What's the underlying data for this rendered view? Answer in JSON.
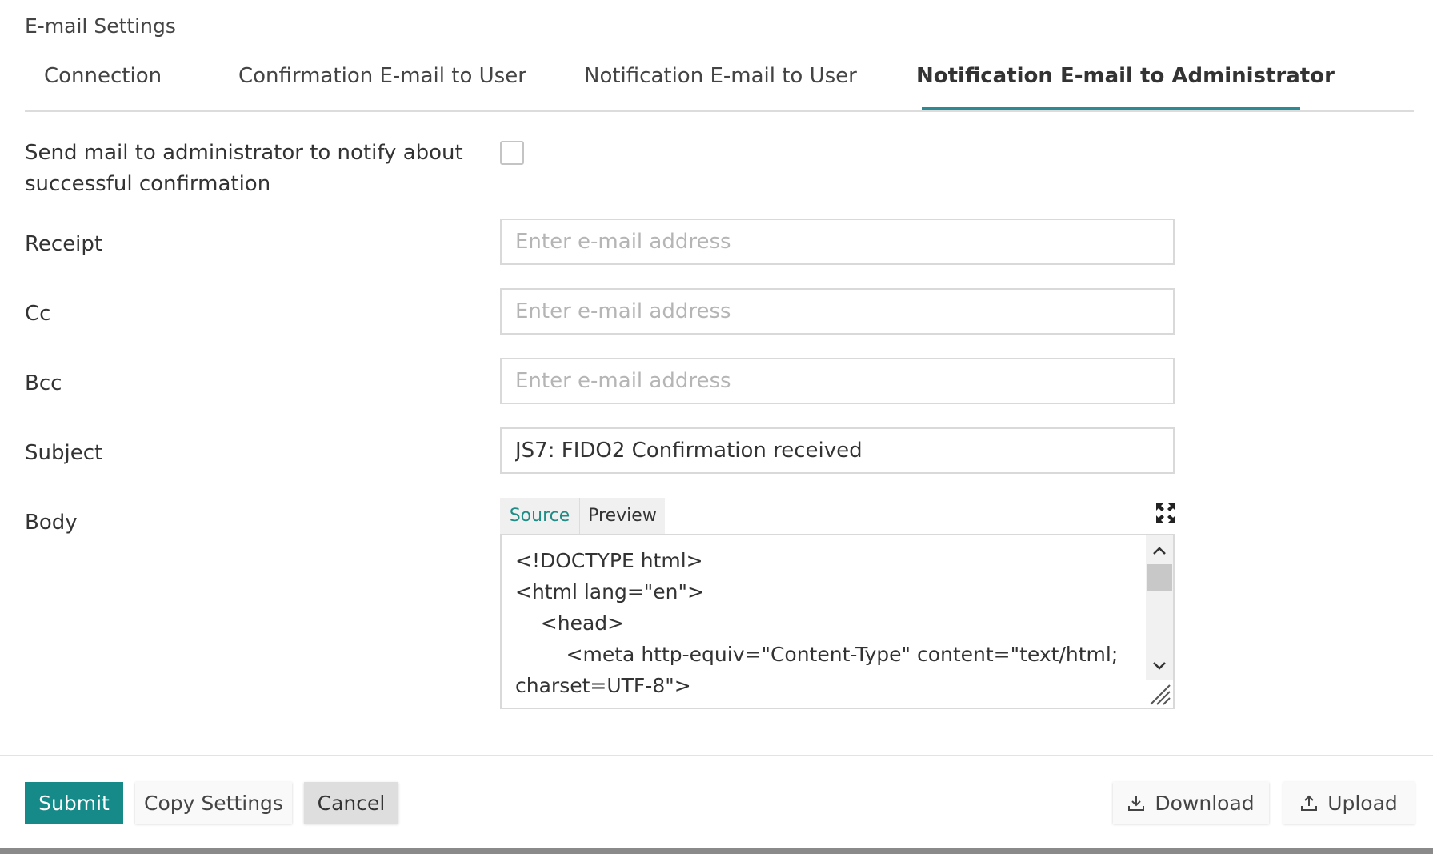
{
  "page": {
    "title": "E-mail Settings"
  },
  "tabs": [
    {
      "label": "Connection",
      "active": false
    },
    {
      "label": "Confirmation E-mail to User",
      "active": false
    },
    {
      "label": "Notification E-mail to User",
      "active": false
    },
    {
      "label": "Notification E-mail to Administrator",
      "active": true
    }
  ],
  "form": {
    "send_mail": {
      "label_line1": "Send mail to administrator to notify about",
      "label_line2": "successful confirmation",
      "checked": false
    },
    "receipt": {
      "label": "Receipt",
      "placeholder": "Enter e-mail address",
      "value": ""
    },
    "cc": {
      "label": "Cc",
      "placeholder": "Enter e-mail address",
      "value": ""
    },
    "bcc": {
      "label": "Bcc",
      "placeholder": "Enter e-mail address",
      "value": ""
    },
    "subject": {
      "label": "Subject",
      "placeholder": "",
      "value": "JS7: FIDO2 Confirmation received"
    },
    "body": {
      "label": "Body",
      "tabs": {
        "source": "Source",
        "preview": "Preview"
      },
      "active_tab": "Source",
      "code_lines": [
        "<!DOCTYPE html>",
        "<html lang=\"en\">",
        "    <head>",
        "        <meta http-equiv=\"Content-Type\" content=\"text/html;",
        "charset=UTF-8\">"
      ]
    }
  },
  "footer": {
    "submit": "Submit",
    "copy_settings": "Copy Settings",
    "cancel": "Cancel",
    "download": "Download",
    "upload": "Upload"
  },
  "icons": {
    "expand": "expand-icon",
    "download": "download-icon",
    "upload": "upload-icon",
    "scroll_up": "chevron-up-icon",
    "scroll_down": "chevron-down-icon"
  },
  "colors": {
    "accent": "#2b8a93",
    "primary_button": "#168a88",
    "source_tab_text": "#1f8c86"
  }
}
